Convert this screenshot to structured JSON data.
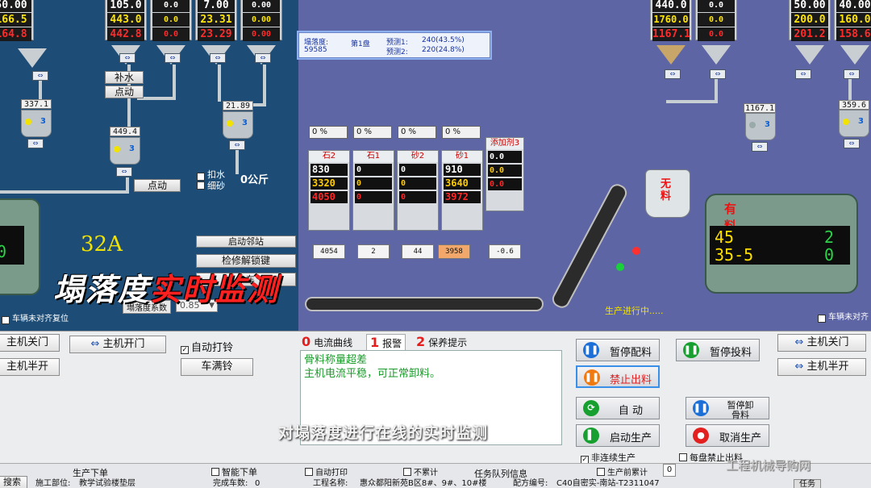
{
  "left_silos": [
    {
      "v1": "50.00",
      "v2": "166.5",
      "v3": "164.8"
    },
    {
      "v1": "105.0",
      "v2": "443.0",
      "v3": "442.8"
    },
    {
      "v1": "0.0",
      "v2": "0.0",
      "v3": "0.0"
    },
    {
      "v1": "7.00",
      "v2": "23.31",
      "v3": "23.29"
    },
    {
      "v1": "0.00",
      "v2": "0.00",
      "v3": "0.00"
    }
  ],
  "left_readouts": {
    "r1": "337.1",
    "r2": "449.4",
    "r3": "21.89"
  },
  "left_scale_numbers": {
    "s1": "3",
    "s2": "3",
    "s3": "3"
  },
  "left_buttons": {
    "water": "补水",
    "jog1": "点动",
    "jog2": "点动",
    "start_station": "启动邻站",
    "inspect": "检修解锁键",
    "this_car": "本车"
  },
  "left_checks": {
    "deduct_water": "扣水",
    "fine_sand": "细砂"
  },
  "left_kg": "0公斤",
  "current_label": "32A",
  "slump_factor_label": "塌落度系数",
  "slump_factor_value": "0.85",
  "left_mixer_screen": {
    "a": "",
    "b": "0"
  },
  "car_leave_left": "车辆未对齐复位",
  "info_box": {
    "slump_label": "塌落度:",
    "slump_value": "59585",
    "batch": "第1盘",
    "pred1_label": "预测1:",
    "pred1_value": "240(43.5%)",
    "pred2_label": "预测2:",
    "pred2_value": "220(24.8%)"
  },
  "agg_bins": [
    {
      "name": "石2",
      "pct": "0 %",
      "v1": "830",
      "v2": "3320",
      "v3": "4050",
      "hopper": "4054"
    },
    {
      "name": "石1",
      "pct": "0 %",
      "v1": "0",
      "v2": "0",
      "v3": "0",
      "hopper": "2"
    },
    {
      "name": "砂2",
      "pct": "0 %",
      "v1": "0",
      "v2": "0",
      "v3": "0",
      "hopper": "44"
    },
    {
      "name": "砂1",
      "pct": "0 %",
      "v1": "910",
      "v2": "3640",
      "v3": "3972",
      "hopper": "3958"
    }
  ],
  "additive": {
    "name": "添加剂3",
    "v1": "0.0",
    "v2": "0.0",
    "v3": "0.0",
    "hopper": "-0.6"
  },
  "no_material": "无料",
  "has_material": "有料",
  "right_mixer_screen": {
    "a": "45",
    "b": "2",
    "c": "35-5",
    "d": "0"
  },
  "production_status": "生产进行中.....",
  "car_leave_right": "车辆未对齐",
  "right_silos": [
    {
      "v1": "440.0",
      "v2": "1760.0",
      "v3": "1167.1"
    },
    {
      "v1": "0.0",
      "v2": "0.0",
      "v3": "0.0"
    },
    {
      "v1": "50.00",
      "v2": "200.0",
      "v3": "201.2"
    },
    {
      "v1": "40.00",
      "v2": "160.0",
      "v3": "158.6"
    }
  ],
  "right_readouts": {
    "r1": "1167.1",
    "r2": "359.6"
  },
  "right_scale_numbers": {
    "s1": "3",
    "s2": "3"
  },
  "hero": {
    "white": "塌落度",
    "red": "实时监测"
  },
  "panel": {
    "host_close": "主机关门",
    "host_open": "主机开门",
    "host_half": "主机半开",
    "auto_ring": "自动打铃",
    "car_full_ring": "车满铃",
    "host_close_r": "主机关门",
    "host_half_r": "主机半开"
  },
  "tabs": [
    {
      "num": "0",
      "label": "电流曲线"
    },
    {
      "num": "1",
      "label": "报警"
    },
    {
      "num": "2",
      "label": "保养提示"
    }
  ],
  "alarm_lines": {
    "l1": "骨料称量超差",
    "l2": "主机电流平稳，可正常卸料。"
  },
  "controls": {
    "pause_batch": "暂停配料",
    "pause_feed": "暂停投料",
    "stop_discharge": "禁止出料",
    "auto": "自  动",
    "pause_unload": "暂停卸",
    "pause_unload2": "骨料",
    "start_prod": "启动生产",
    "cancel_prod": "取消生产"
  },
  "checks_bottom": {
    "non_continuous": "非连续生产",
    "per_batch_no_discharge": "每盘禁止出料",
    "smart_order": "智能下单",
    "auto_print": "自动打印",
    "no_accumulate": "不累计",
    "before_prod_accumulate": "生产前累计"
  },
  "accumulate_value": "0",
  "order_labels": {
    "prod_order": "生产下单",
    "task_queue": "任务队列信息",
    "search": "搜索"
  },
  "order_row": {
    "site_label": "施工部位:",
    "site_value": "教学试验楼垫层",
    "vehicles_label": "完成车数:",
    "vehicles_value": "0",
    "project_label": "工程名称:",
    "project_value": "惠众都阳新苑B区8#、9#、10#楼",
    "formula_label": "配方编号:",
    "formula_value": "C40自密实-南站-T2311047",
    "task_button": "任务"
  },
  "subtitle": "对塌落度进行在线的实时监测",
  "watermark": "工程机械导购网"
}
